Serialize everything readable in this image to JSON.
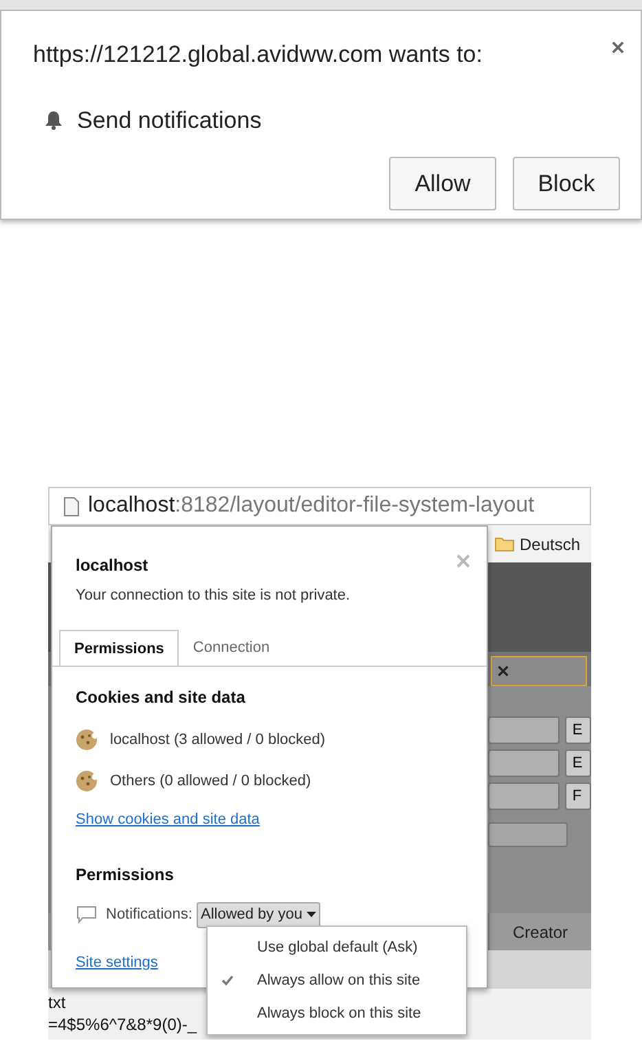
{
  "notification_prompt": {
    "message": "https://121212.global.avidww.com wants to:",
    "permission": "Send notifications",
    "buttons": [
      "Allow",
      "Block"
    ]
  },
  "browser": {
    "address_bar": {
      "host": "localhost",
      "path": ":8182/layout/editor-file-system-layout"
    },
    "bookmarks": [
      "Deutsch"
    ],
    "page": {
      "side_buttons": [
        "E",
        "E",
        "F"
      ],
      "table_columns": [
        "Creator"
      ],
      "text_lines": [
        "txt",
        "=4$5%6^7&8*9(0)-_"
      ]
    },
    "site_info": {
      "title": "localhost",
      "subtitle": "Your connection to this site is not private.",
      "tabs": [
        {
          "label": "Permissions",
          "selected": true
        },
        {
          "label": "Connection",
          "selected": false
        }
      ],
      "cookies_heading": "Cookies and site data",
      "cookies": [
        "localhost (3 allowed / 0 blocked)",
        "Others (0 allowed / 0 blocked)"
      ],
      "cookies_link": "Show cookies and site data",
      "permissions_heading": "Permissions",
      "permissions": [
        {
          "label": "Notifications:",
          "value": "Allowed by you"
        }
      ],
      "settings_link": "Site settings",
      "menu": [
        {
          "label": "Use global default (Ask)",
          "selected": false
        },
        {
          "label": "Always allow on this site",
          "selected": true
        },
        {
          "label": "Always block on this site",
          "selected": false
        }
      ]
    }
  }
}
